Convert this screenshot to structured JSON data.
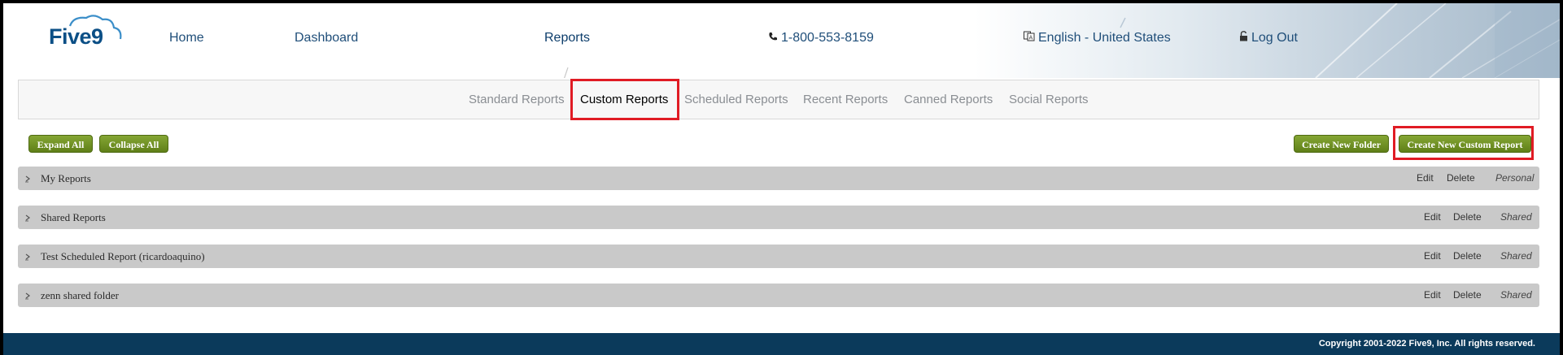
{
  "header": {
    "logo_text": "Five9",
    "nav": {
      "home": "Home",
      "dashboard": "Dashboard",
      "reports": "Reports",
      "phone": "1-800-553-8159",
      "language": "English - United States",
      "logout": "Log Out"
    },
    "icons": {
      "phone": "phone-icon",
      "language": "language-icon",
      "logout": "lock-icon"
    }
  },
  "subnav": {
    "tabs": [
      {
        "label": "Standard Reports"
      },
      {
        "label": "Custom Reports",
        "active": true
      },
      {
        "label": "Scheduled Reports"
      },
      {
        "label": "Recent Reports"
      },
      {
        "label": "Canned Reports"
      },
      {
        "label": "Social Reports"
      }
    ]
  },
  "toolbar": {
    "expand_all": "Expand All",
    "collapse_all": "Collapse All",
    "create_folder": "Create New Folder",
    "create_report": "Create New Custom Report"
  },
  "folders": [
    {
      "name": "My Reports",
      "edit": "Edit",
      "delete": "Delete",
      "scope": "Personal"
    },
    {
      "name": "Shared Reports",
      "edit": "Edit",
      "delete": "Delete",
      "scope": "Shared"
    },
    {
      "name": "Test Scheduled Report (ricardoaquino)",
      "edit": "Edit",
      "delete": "Delete",
      "scope": "Shared"
    },
    {
      "name": "zenn shared folder",
      "edit": "Edit",
      "delete": "Delete",
      "scope": "Shared"
    }
  ],
  "footer": {
    "copyright": "Copyright 2001-2022 Five9, Inc. All rights reserved."
  },
  "colors": {
    "accent_green": "#6a8c1f",
    "footer_bg": "#0b3a5b",
    "highlight_red": "#e01b24",
    "nav_text": "#1f4e79"
  }
}
